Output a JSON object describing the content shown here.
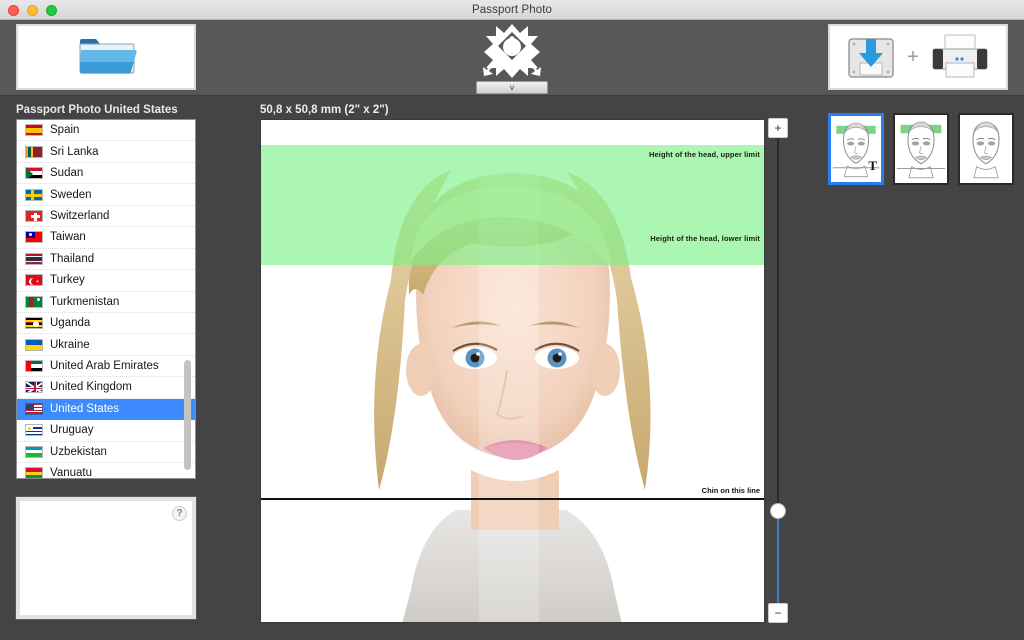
{
  "window": {
    "title": "Passport Photo",
    "traffic_lights": [
      "close-red",
      "minimize-yellow",
      "zoom-green"
    ]
  },
  "toolbar": {
    "open_button": {
      "icon": "folder-icon",
      "label": ""
    },
    "center_tool": {
      "icon": "crop-rotate-icon",
      "dropdown_glyph": "v"
    },
    "save_print": {
      "save_icon": "save-disk-icon",
      "separator": "+",
      "print_icon": "printer-icon"
    }
  },
  "sidebar": {
    "heading": "Passport Photo United States",
    "countries": [
      {
        "name": "Spain",
        "flag": "spain-flag",
        "selected": false
      },
      {
        "name": "Sri Lanka",
        "flag": "sri-lanka-flag",
        "selected": false
      },
      {
        "name": "Sudan",
        "flag": "sudan-flag",
        "selected": false
      },
      {
        "name": "Sweden",
        "flag": "sweden-flag",
        "selected": false
      },
      {
        "name": "Switzerland",
        "flag": "switzerland-flag",
        "selected": false
      },
      {
        "name": "Taiwan",
        "flag": "taiwan-flag",
        "selected": false
      },
      {
        "name": "Thailand",
        "flag": "thailand-flag",
        "selected": false
      },
      {
        "name": "Turkey",
        "flag": "turkey-flag",
        "selected": false
      },
      {
        "name": "Turkmenistan",
        "flag": "turkmenistan-flag",
        "selected": false
      },
      {
        "name": "Uganda",
        "flag": "uganda-flag",
        "selected": false
      },
      {
        "name": "Ukraine",
        "flag": "ukraine-flag",
        "selected": false
      },
      {
        "name": "United Arab Emirates",
        "flag": "uae-flag",
        "selected": false
      },
      {
        "name": "United Kingdom",
        "flag": "uk-flag",
        "selected": false
      },
      {
        "name": "United States",
        "flag": "usa-flag",
        "selected": true
      },
      {
        "name": "Uruguay",
        "flag": "uruguay-flag",
        "selected": false
      },
      {
        "name": "Uzbekistan",
        "flag": "uzbekistan-flag",
        "selected": false
      },
      {
        "name": "Vanuatu",
        "flag": "vanuatu-flag",
        "selected": false
      }
    ],
    "help_panel": {
      "help_glyph": "?"
    }
  },
  "photo": {
    "size_label": "50,8 x 50,8 mm (2\" x 2\")",
    "guides": {
      "head_upper_limit": "Height of the head, upper limit",
      "head_lower_limit": "Height of the head, lower limit",
      "chin_line": "Chin on this line"
    },
    "overlay_color": "#78F082",
    "chin_line_color": "#111111"
  },
  "zoom_control": {
    "plus_label": "+",
    "minus_label": "−",
    "accent_color": "#3F7EC4"
  },
  "thumbnails": [
    {
      "name": "template-with-guides",
      "badge": "T",
      "selected": true,
      "guides": true
    },
    {
      "name": "template-green-band",
      "badge": "",
      "selected": false,
      "guides": true
    },
    {
      "name": "template-plain",
      "badge": "",
      "selected": false,
      "guides": false
    }
  ]
}
